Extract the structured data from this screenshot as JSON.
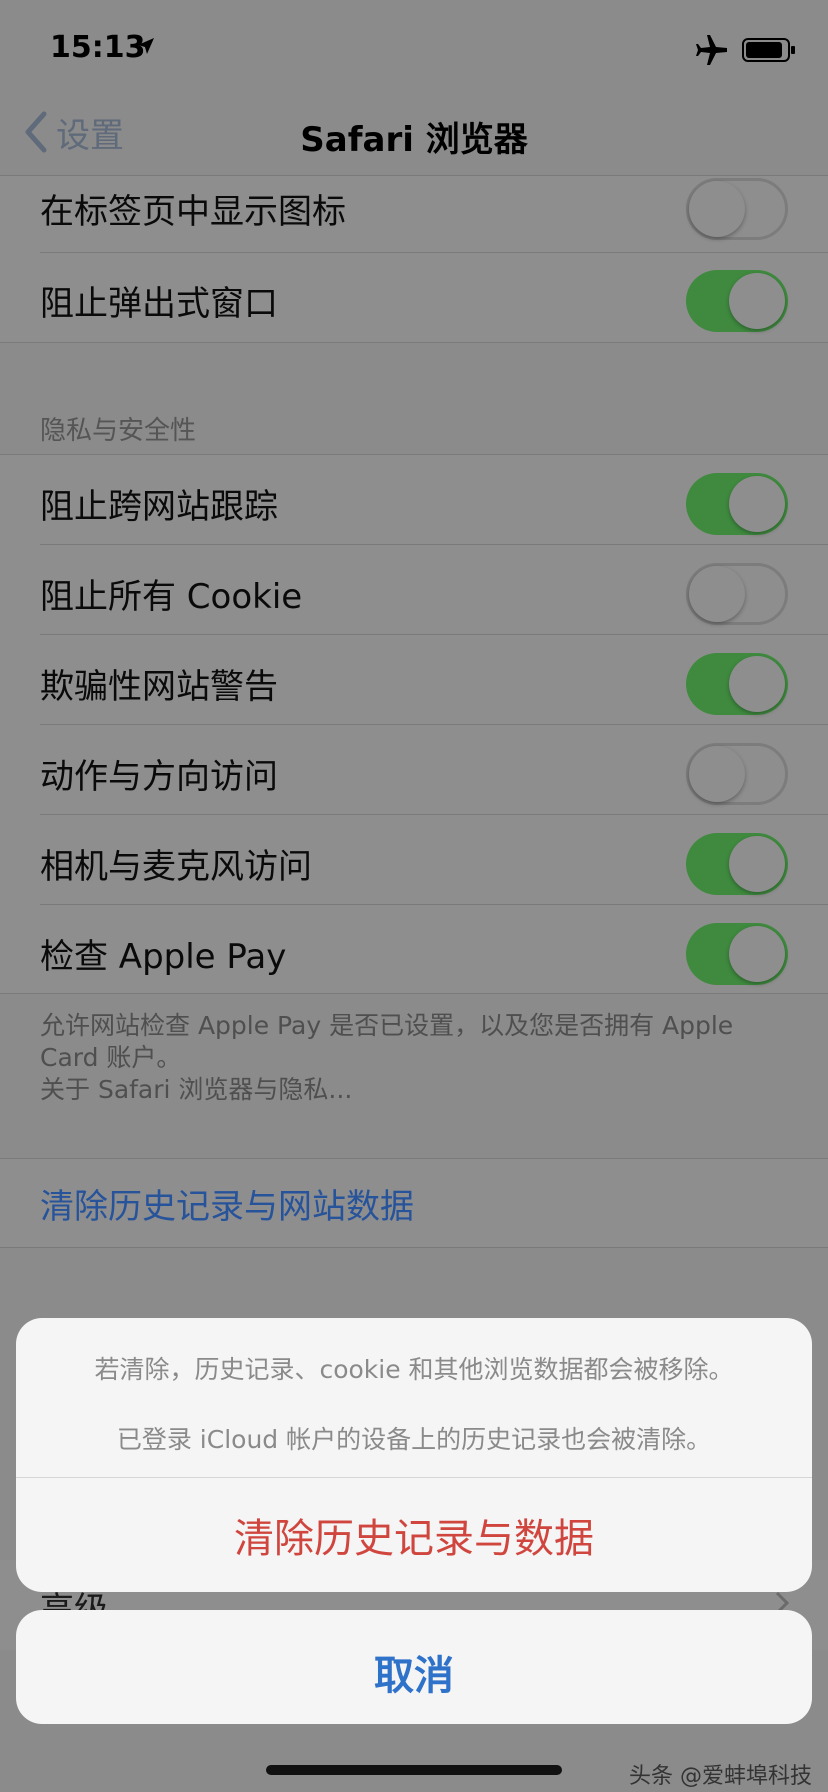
{
  "status_bar": {
    "time": "15:13"
  },
  "nav": {
    "back_label": "设置",
    "title": "Safari 浏览器"
  },
  "general_rows": [
    {
      "label": "在标签页中显示图标",
      "on": false
    },
    {
      "label": "阻止弹出式窗口",
      "on": true
    }
  ],
  "privacy": {
    "header": "隐私与安全性",
    "rows": [
      {
        "label": "阻止跨网站跟踪",
        "on": true
      },
      {
        "label": "阻止所有 Cookie",
        "on": false
      },
      {
        "label": "欺骗性网站警告",
        "on": true
      },
      {
        "label": "动作与方向访问",
        "on": false
      },
      {
        "label": "相机与麦克风访问",
        "on": true
      },
      {
        "label": "检查 Apple Pay",
        "on": true
      }
    ],
    "footer_line1": "允许网站检查 Apple Pay 是否已设置，以及您是否拥有 Apple",
    "footer_line2": "Card 账户。",
    "footer_link": "关于 Safari 浏览器与隐私..."
  },
  "clear_row_label": "清除历史记录与网站数据",
  "under_sheet_label": "高级",
  "action_sheet": {
    "message_line1": "若清除，历史记录、cookie 和其他浏览数据都会被移除。",
    "message_line2": "已登录 iCloud 帐户的设备上的历史记录也会被清除。",
    "destructive_label": "清除历史记录与数据",
    "cancel_label": "取消"
  },
  "watermark": "头条 @爱蚌埠科技",
  "colors": {
    "toggle_on": "#3f8a3f",
    "destructive": "#d0463f",
    "link": "#2f72c9"
  }
}
